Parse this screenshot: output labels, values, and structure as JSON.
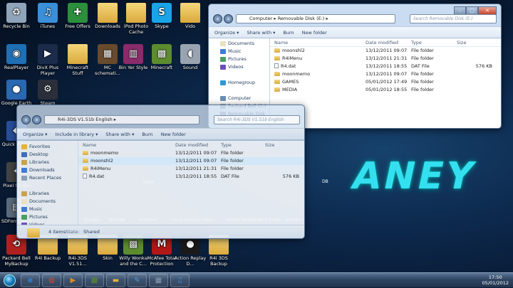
{
  "desktop": {
    "graffiti_text": "ANEY",
    "icons": [
      {
        "label": "Recycle Bin",
        "icon": "recycle-bin-icon",
        "glyph": "♻",
        "color": "#8fa4b8"
      },
      {
        "label": "iTunes",
        "icon": "itunes-icon",
        "glyph": "♫",
        "color": "#3a8fd8"
      },
      {
        "label": "Free Offers",
        "icon": "gift-icon",
        "glyph": "✚",
        "color": "#2c8f3c"
      },
      {
        "label": "Downloads",
        "icon": "folder-icon",
        "glyph": "",
        "color": "folder"
      },
      {
        "label": "iPod Photo Cache",
        "icon": "folder-icon",
        "glyph": "",
        "color": "folder"
      },
      {
        "label": "Skype",
        "icon": "skype-icon",
        "glyph": "S",
        "color": "#1aa4e8"
      },
      {
        "label": "Vido",
        "icon": "folder-icon",
        "glyph": "",
        "color": "folder"
      },
      {
        "label": "RealPlayer",
        "icon": "realplayer-icon",
        "glyph": "◉",
        "color": "#1f6fb5"
      },
      {
        "label": "DivX Plus Player",
        "icon": "divx-icon",
        "glyph": "▶",
        "color": "#1b2b4a"
      },
      {
        "label": "Minecraft Stuff",
        "icon": "folder-icon",
        "glyph": "",
        "color": "folder"
      },
      {
        "label": "MC schemati...",
        "icon": "minecraft-schematic-icon",
        "glyph": "▦",
        "color": "#6a4a2c"
      },
      {
        "label": "Bin Yer Style",
        "icon": "winrar-icon",
        "glyph": "▥",
        "color": "#8a2b6a"
      },
      {
        "label": "Minecraft",
        "icon": "minecraft-icon",
        "glyph": "▩",
        "color": "#5d8c2f"
      },
      {
        "label": "Sound",
        "icon": "speaker-icon",
        "glyph": "◖",
        "color": "#9aa4b0"
      },
      {
        "label": "Google Earth",
        "icon": "google-earth-icon",
        "glyph": "●",
        "color": "#2a68b0"
      },
      {
        "label": "Steam",
        "icon": "steam-icon",
        "glyph": "⚙",
        "color": "#2a2f3a"
      },
      {
        "label": "Quick Player",
        "icon": "quick-player-icon",
        "glyph": "◆",
        "color": "#274f9a"
      },
      {
        "label": "Pixel Studio",
        "icon": "pixel-icon",
        "glyph": "✦",
        "color": "#444"
      },
      {
        "label": "SDForm V2.0",
        "icon": "sdformatter-icon",
        "glyph": "▤",
        "color": "#5a6b7a"
      },
      {
        "label": "Packard Bell MyBackup",
        "icon": "backup-icon",
        "glyph": "⟲",
        "color": "#b02020"
      },
      {
        "label": "R4i Backup",
        "icon": "folder-icon",
        "glyph": "",
        "color": "folder"
      },
      {
        "label": "R4i-3DS V1.51...",
        "icon": "folder-icon",
        "glyph": "",
        "color": "folder"
      },
      {
        "label": "Skin",
        "icon": "folder-icon",
        "glyph": "",
        "color": "folder"
      },
      {
        "label": "Willy Wonka and the C...",
        "icon": "minecraft-block-icon",
        "glyph": "▩",
        "color": "#5d8c2f"
      },
      {
        "label": "McAfee Total Protection",
        "icon": "mcafee-icon",
        "glyph": "M",
        "color": "#b01818"
      },
      {
        "label": "Action Replay D...",
        "icon": "action-replay-icon",
        "glyph": "●",
        "color": "#1a1a1a"
      },
      {
        "label": "R4i 3DS Backup",
        "icon": "folder-icon",
        "glyph": "",
        "color": "folder"
      }
    ],
    "ghost_labels": [
      "Google",
      "YouTube",
      "Grabbed",
      "Sony Ericsson",
      "WALL",
      "Adobe Reader X",
      "Dan's Guide",
      "wonder",
      "Tasch"
    ],
    "stray_label": "DB"
  },
  "back_window": {
    "address": "Computer ▸ Removable Disk (E:) ▸",
    "search_placeholder": "Search Removable Disk (E:)",
    "toolbar": [
      "Organize ▾",
      "Share with ▾",
      "Burn",
      "New folder"
    ],
    "nav_items": [
      {
        "label": "Documents",
        "color": "#e8e0c0"
      },
      {
        "label": "Music",
        "color": "#3d7bd8"
      },
      {
        "label": "Pictures",
        "color": "#4a9e62"
      },
      {
        "label": "Videos",
        "color": "#6a4fb8"
      },
      {
        "label": "",
        "color": ""
      },
      {
        "label": "Homegroup",
        "color": "#2a9ad8"
      },
      {
        "label": "",
        "color": ""
      },
      {
        "label": "Computer",
        "color": "#6a8fb8"
      },
      {
        "label": "Packard Bell (C:)",
        "color": "#9aaab8"
      },
      {
        "label": "Removable Disk",
        "color": "#9aaab8"
      }
    ],
    "columns": [
      "Name",
      "Date modified",
      "Type",
      "Size"
    ],
    "rows": [
      {
        "name": "moonshl2",
        "date": "13/12/2011 09:07",
        "type": "File folder",
        "size": "",
        "kind": "folder"
      },
      {
        "name": "R4iMenu",
        "date": "13/12/2011 21:31",
        "type": "File folder",
        "size": "",
        "kind": "folder"
      },
      {
        "name": "R4.dat",
        "date": "13/12/2011 18:55",
        "type": "DAT File",
        "size": "576 KB",
        "kind": "file"
      },
      {
        "name": "moonmemo",
        "date": "13/12/2011 09:07",
        "type": "File folder",
        "size": "",
        "kind": "folder"
      },
      {
        "name": "GAMES",
        "date": "05/01/2012 17:49",
        "type": "File folder",
        "size": "",
        "kind": "folder"
      },
      {
        "name": "MEDIA",
        "date": "05/01/2012 18:55",
        "type": "File folder",
        "size": "",
        "kind": "folder"
      }
    ]
  },
  "front_window": {
    "address": "R4i-3DS V1.51b English ▸",
    "search_placeholder": "Search R4i-3DS V1.51b English",
    "toolbar": [
      "Organize ▾",
      "Include in library ▾",
      "Share with ▾",
      "Burn",
      "New folder"
    ],
    "nav_items": [
      {
        "label": "Favorites",
        "color": "#e3b23c"
      },
      {
        "label": "Desktop",
        "color": "#3d6fb8"
      },
      {
        "label": "Libraries",
        "color": "#c9a24a"
      },
      {
        "label": "Downloads",
        "color": "#3d7bd8"
      },
      {
        "label": "Recent Places",
        "color": "#8aa0b8"
      },
      {
        "label": "",
        "color": ""
      },
      {
        "label": "Libraries",
        "color": "#c9a24a"
      },
      {
        "label": "Documents",
        "color": "#e8e0c0"
      },
      {
        "label": "Music",
        "color": "#3d7bd8"
      },
      {
        "label": "Pictures",
        "color": "#4a9e62"
      },
      {
        "label": "Videos",
        "color": "#6a4fb8"
      }
    ],
    "columns": [
      "Name",
      "Date modified",
      "Type",
      "Size"
    ],
    "rows": [
      {
        "name": "moonmemo",
        "date": "13/12/2011 09:07",
        "type": "File folder",
        "size": "",
        "kind": "folder"
      },
      {
        "name": "moonshl2",
        "date": "13/12/2011 09:07",
        "type": "File folder",
        "size": "",
        "kind": "folder"
      },
      {
        "name": "R4iMenu",
        "date": "13/12/2011 21:31",
        "type": "File folder",
        "size": "",
        "kind": "folder"
      },
      {
        "name": "R4.dat",
        "date": "13/12/2011 18:55",
        "type": "DAT File",
        "size": "576 KB",
        "kind": "file"
      }
    ],
    "status": {
      "count": "4 items",
      "state_label": "State:",
      "state_value": "Shared"
    }
  },
  "taskbar": {
    "pinned": [
      {
        "name": "ie-icon",
        "glyph": "e",
        "color": "#2a86d8"
      },
      {
        "name": "chrome-icon",
        "glyph": "◍",
        "color": "#d84a2a"
      },
      {
        "name": "media-player-icon",
        "glyph": "▶",
        "color": "#e08a1a"
      },
      {
        "name": "minecraft-taskbar-icon",
        "glyph": "▩",
        "color": "#5d8c2f"
      },
      {
        "name": "explorer-taskbar-icon",
        "glyph": "▬",
        "color": "#e3b23c"
      },
      {
        "name": "paint-icon",
        "glyph": "✎",
        "color": "#4a9ed8"
      },
      {
        "name": "calculator-icon",
        "glyph": "▦",
        "color": "#8a9ab0"
      },
      {
        "name": "itunes-taskbar-icon",
        "glyph": "♫",
        "color": "#3a8fd8"
      }
    ],
    "time": "17:50",
    "date": "05/01/2012"
  }
}
